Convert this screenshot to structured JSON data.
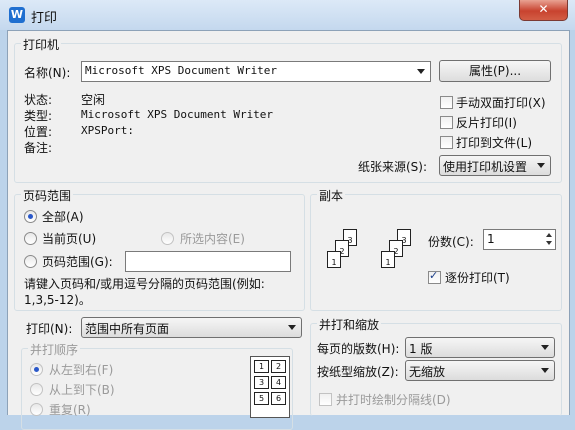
{
  "window": {
    "title": "打印",
    "app_icon_letter": "W",
    "close": "✕"
  },
  "printer": {
    "legend": "打印机",
    "name_label": "名称(N):",
    "name_value": "Microsoft XPS Document Writer",
    "properties_button": "属性(P)...",
    "status_label": "状态:",
    "status_value": "空闲",
    "type_label": "类型:",
    "type_value": "Microsoft XPS Document Writer",
    "location_label": "位置:",
    "location_value": "XPSPort:",
    "comment_label": "备注:",
    "duplex_label": "手动双面打印(X)",
    "duplex_checked": false,
    "reverse_label": "反片打印(I)",
    "reverse_checked": false,
    "to_file_label": "打印到文件(L)",
    "to_file_checked": false,
    "paper_source_label": "纸张来源(S):",
    "paper_source_value": "使用打印机设置"
  },
  "page_range": {
    "legend": "页码范围",
    "all_label": "全部(A)",
    "all_selected": true,
    "current_label": "当前页(U)",
    "selection_label": "所选内容(E)",
    "pages_label": "页码范围(G):",
    "pages_value": "",
    "hint_line1": "请键入页码和/或用逗号分隔的页码范围(例如:",
    "hint_line2": "1,3,5-12)。"
  },
  "copies": {
    "legend": "副本",
    "count_label": "份数(C):",
    "count_value": "1",
    "collate_label": "逐份打印(T)",
    "collate_checked": true,
    "page_numbers": [
      "1",
      "2",
      "3"
    ]
  },
  "print_what": {
    "label": "打印(N):",
    "value": "范围中所有页面"
  },
  "order": {
    "legend": "并打顺序",
    "ltr_label": "从左到右(F)",
    "ltr_selected": true,
    "ttb_label": "从上到下(B)",
    "repeat_label": "重复(R)",
    "grid_numbers": [
      "1",
      "2",
      "3",
      "4",
      "5",
      "6"
    ]
  },
  "zoom": {
    "legend": "并打和缩放",
    "pages_per_sheet_label": "每页的版数(H):",
    "pages_per_sheet_value": "1 版",
    "scale_label": "按纸型缩放(Z):",
    "scale_value": "无缩放",
    "draw_divider_label": "并打时绘制分隔线(D)",
    "draw_divider_checked": false
  }
}
